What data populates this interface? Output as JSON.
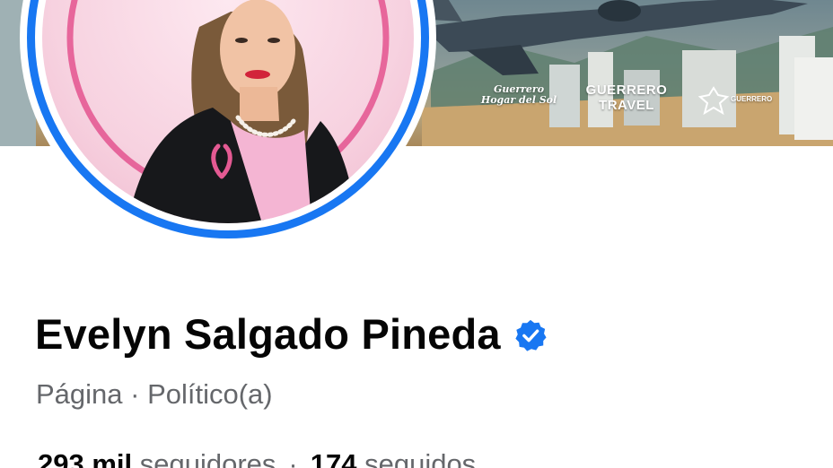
{
  "profile": {
    "name": "Evelyn Salgado Pineda",
    "category": "Página · Político(a)",
    "followers_count": "293 mil",
    "followers_label": "seguidores",
    "separator": "·",
    "following_count": "174",
    "following_label": "seguidos",
    "verified_icon": "verified-badge-icon"
  },
  "cover": {
    "logo_1": "Guerrero Hogar del Sol",
    "logo_2": "GUERRERO TRAVEL",
    "logo_3": "GUERRERO"
  },
  "colors": {
    "verified_blue": "#1877f2",
    "ring_blue": "#1877f2",
    "ring_pink": "#e45a93",
    "name_text": "#050505",
    "secondary_text": "#65676b"
  }
}
